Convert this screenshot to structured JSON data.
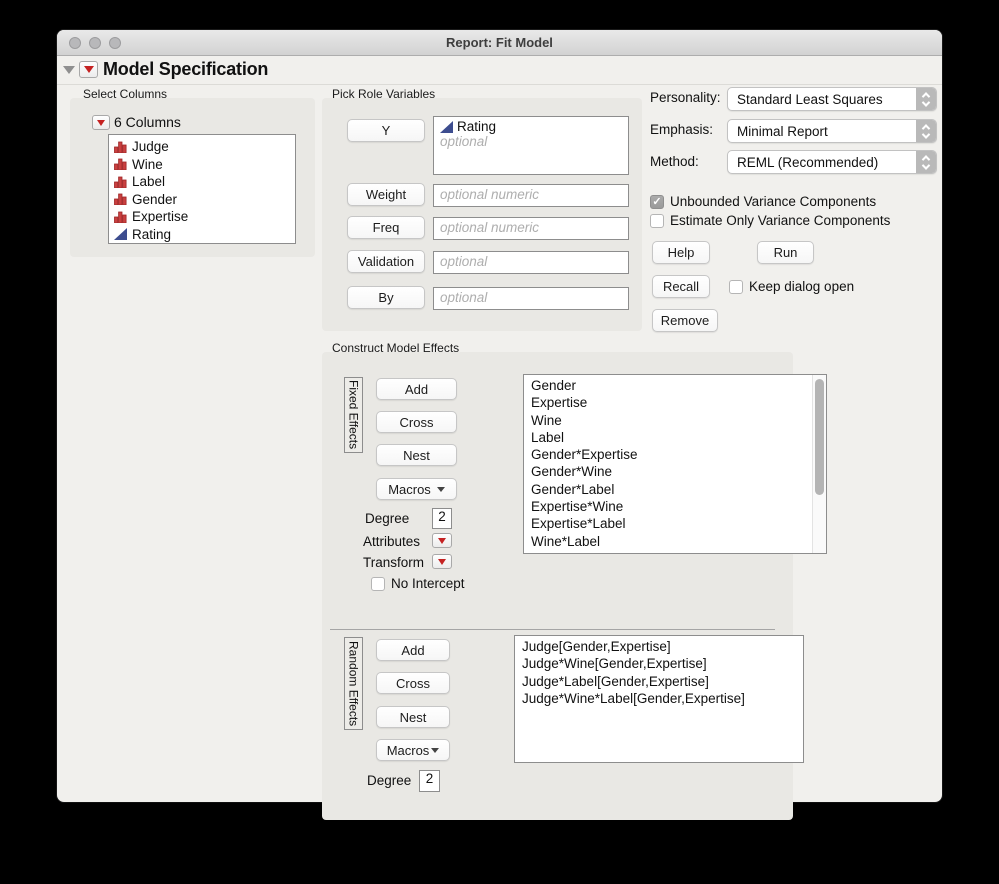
{
  "window": {
    "title": "Report: Fit Model",
    "header": "Model Specification"
  },
  "select_columns": {
    "label": "Select Columns",
    "group_label": "6 Columns",
    "columns": [
      {
        "name": "Judge",
        "type": "nominal"
      },
      {
        "name": "Wine",
        "type": "nominal"
      },
      {
        "name": "Label",
        "type": "nominal"
      },
      {
        "name": "Gender",
        "type": "nominal"
      },
      {
        "name": "Expertise",
        "type": "nominal"
      },
      {
        "name": "Rating",
        "type": "continuous"
      }
    ]
  },
  "pick_roles": {
    "label": "Pick Role Variables",
    "y_button": "Y",
    "y_value": "Rating",
    "y_placeholder": "optional",
    "rows": [
      {
        "button": "Weight",
        "placeholder": "optional numeric"
      },
      {
        "button": "Freq",
        "placeholder": "optional numeric"
      },
      {
        "button": "Validation",
        "placeholder": "optional"
      },
      {
        "button": "By",
        "placeholder": "optional"
      }
    ]
  },
  "options": {
    "personality_label": "Personality:",
    "personality_value": "Standard Least Squares",
    "emphasis_label": "Emphasis:",
    "emphasis_value": "Minimal Report",
    "method_label": "Method:",
    "method_value": "REML (Recommended)",
    "unbounded_label": "Unbounded Variance Components",
    "estimate_only_label": "Estimate Only Variance Components",
    "help_label": "Help",
    "run_label": "Run",
    "recall_label": "Recall",
    "keep_dialog_label": "Keep dialog open",
    "remove_label": "Remove"
  },
  "model_effects": {
    "label": "Construct Model Effects",
    "fixed": {
      "title": "Fixed Effects",
      "add": "Add",
      "cross": "Cross",
      "nest": "Nest",
      "macros": "Macros",
      "degree_label": "Degree",
      "degree_value": "2",
      "attributes_label": "Attributes",
      "transform_label": "Transform",
      "no_intercept_label": "No Intercept",
      "effects": [
        "Gender",
        "Expertise",
        "Wine",
        "Label",
        "Gender*Expertise",
        "Gender*Wine",
        "Gender*Label",
        "Expertise*Wine",
        "Expertise*Label",
        "Wine*Label"
      ]
    },
    "random": {
      "title": "Random Effects",
      "add": "Add",
      "cross": "Cross",
      "nest": "Nest",
      "macros": "Macros",
      "degree_label": "Degree",
      "degree_value": "2",
      "effects": [
        "Judge[Gender,Expertise]",
        "Judge*Wine[Gender,Expertise]",
        "Judge*Label[Gender,Expertise]",
        "Judge*Wine*Label[Gender,Expertise]"
      ]
    }
  },
  "colors": {
    "accent_red": "#c52222",
    "continuous_blue": "#3d4d8f",
    "panel_gray": "#e9e8e4"
  }
}
